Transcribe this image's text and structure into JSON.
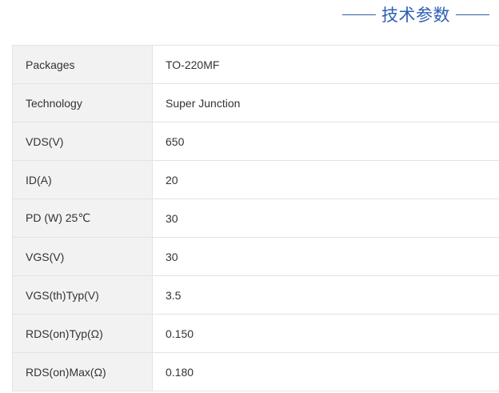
{
  "section": {
    "title": "技术参数"
  },
  "specs": {
    "rows": [
      {
        "label": "Packages",
        "value": "TO-220MF"
      },
      {
        "label": "Technology",
        "value": "Super Junction"
      },
      {
        "label": "VDS(V)",
        "value": "650"
      },
      {
        "label": "ID(A)",
        "value": "20"
      },
      {
        "label": "PD (W) 25℃",
        "value": "30"
      },
      {
        "label": "VGS(V)",
        "value": "30"
      },
      {
        "label": "VGS(th)Typ(V)",
        "value": "3.5"
      },
      {
        "label": "RDS(on)Typ(Ω)",
        "value": "0.150"
      },
      {
        "label": "RDS(on)Max(Ω)",
        "value": "0.180"
      }
    ]
  }
}
